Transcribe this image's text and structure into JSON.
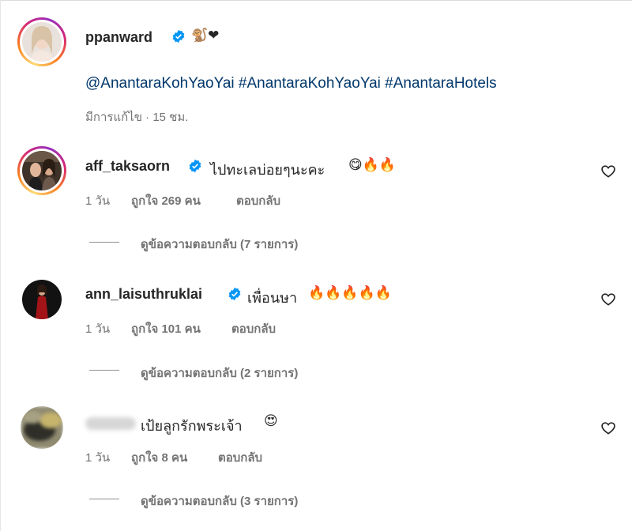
{
  "post": {
    "username": "ppanward",
    "caption_emoji": "🐒❤",
    "hashtags": "@AnantaraKohYaoYai #AnantaraKohYaoYai #AnantaraHotels",
    "meta": "มีการแก้ไข · 15 ชม."
  },
  "comments": [
    {
      "username": "aff_taksaorn",
      "text": "ไปทะเลบ่อยๆนะคะ",
      "emoji": "😋🔥🔥",
      "time": "1 วัน",
      "likes": "ถูกใจ 269 คน",
      "reply": "ตอบกลับ",
      "view_replies": "ดูข้อความตอบกลับ (7 รายการ)"
    },
    {
      "username": "ann_laisuthruklai",
      "text": "เพื่อนษา",
      "emoji": "🔥🔥🔥🔥🔥",
      "time": "1 วัน",
      "likes": "ถูกใจ 101 คน",
      "reply": "ตอบกลับ",
      "view_replies": "ดูข้อความตอบกลับ (2 รายการ)"
    },
    {
      "username": "",
      "text": "เป้ยลูกรักพระเจ้า",
      "emoji": "😍",
      "time": "1 วัน",
      "likes": "ถูกใจ 8 คน",
      "reply": "ตอบกลับ",
      "view_replies": "ดูข้อความตอบกลับ (3 รายการ)"
    }
  ],
  "colors": {
    "link": "#00376b",
    "verified": "#0095f6",
    "muted": "#737373"
  },
  "icons": [
    "verified-badge-icon",
    "heart-icon"
  ]
}
